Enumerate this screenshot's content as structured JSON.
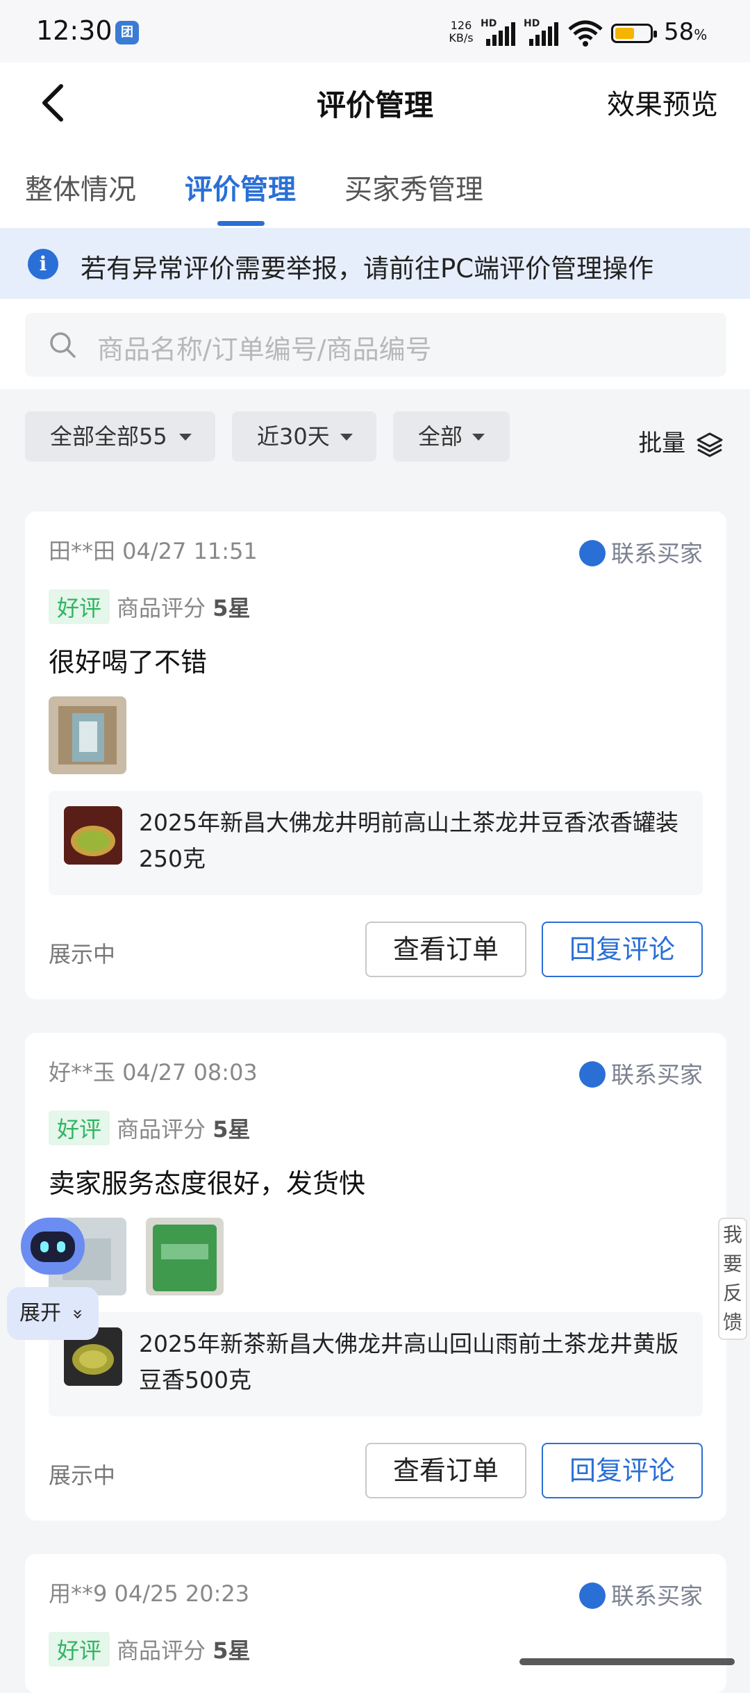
{
  "status_bar": {
    "time": "12:30",
    "app_icon_text": "团",
    "net_speed_value": "126",
    "net_speed_unit": "KB/s",
    "sim1_label": "HD",
    "sim2_label": "HD",
    "battery_percent": "58",
    "battery_suffix": "%"
  },
  "header": {
    "title": "评价管理",
    "preview_label": "效果预览"
  },
  "tabs": [
    {
      "label": "整体情况"
    },
    {
      "label": "评价管理"
    },
    {
      "label": "买家秀管理"
    }
  ],
  "notice": {
    "icon_text": "i",
    "text": "若有异常评价需要举报，请前往PC端评价管理操作"
  },
  "search": {
    "placeholder": "商品名称/订单编号/商品编号"
  },
  "filters": {
    "status": "全部全部55",
    "period": "近30天",
    "type": "全部",
    "batch": "批量"
  },
  "reviews": [
    {
      "user": "田**田 04/27 11:51",
      "contact": "联系买家",
      "tag": "好评",
      "rating_label": "商品评分",
      "rating_value": "5星",
      "content": "很好喝了不错",
      "product_name": "2025年新昌大佛龙井明前高山土茶龙井豆香浓香罐装250克",
      "state": "展示中",
      "order_btn": "查看订单",
      "reply_btn": "回复评论"
    },
    {
      "user": "好**玉 04/27 08:03",
      "contact": "联系买家",
      "tag": "好评",
      "rating_label": "商品评分",
      "rating_value": "5星",
      "content": "卖家服务态度很好，发货快",
      "product_name": "2025年新茶新昌大佛龙井高山回山雨前土茶龙井黄版豆香500克",
      "state": "展示中",
      "order_btn": "查看订单",
      "reply_btn": "回复评论"
    },
    {
      "user": "用**9 04/25 20:23",
      "contact": "联系买家",
      "tag": "好评",
      "rating_label": "商品评分",
      "rating_value": "5星"
    }
  ],
  "assistant": {
    "expand_label": "展开",
    "chevron": "»"
  },
  "feedback": {
    "chars": [
      "我",
      "要",
      "反",
      "馈"
    ]
  },
  "colors": {
    "accent": "#2a6fd6",
    "good_tag_text": "#2fb563",
    "good_tag_bg": "#e5f6ea",
    "notice_bg": "#e6eefc"
  }
}
